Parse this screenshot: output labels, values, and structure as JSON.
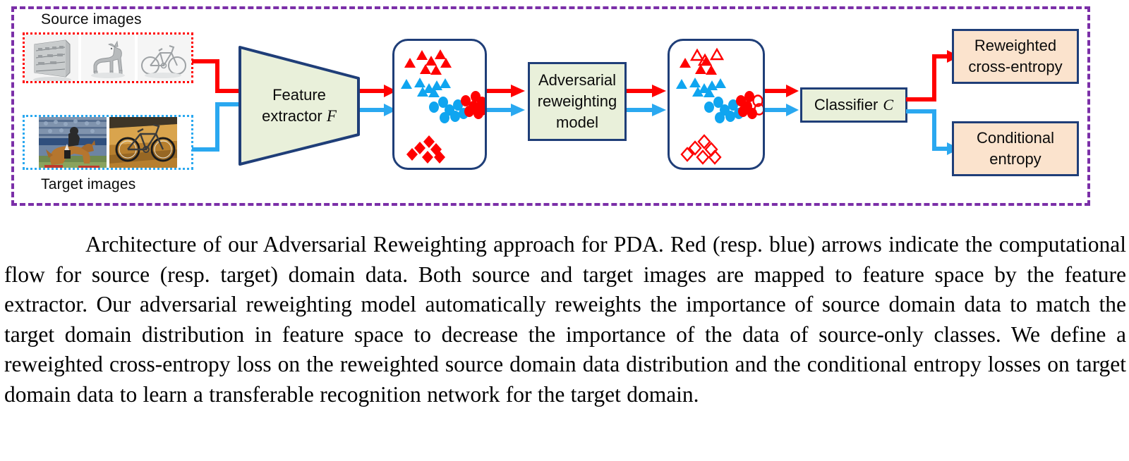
{
  "figure": {
    "outer_frame_color": "#7b2fa8",
    "source_label": "Source images",
    "target_label": "Target images",
    "source_border_color": "#ff0000",
    "target_border_color": "#2aa8f0",
    "source_thumbnails": [
      {
        "name": "synthetic-shelf-image",
        "alt": "grayscale synthetic rendering of a shelf unit"
      },
      {
        "name": "synthetic-horse-image",
        "alt": "grayscale synthetic rendering of a horse"
      },
      {
        "name": "synthetic-bicycle-image",
        "alt": "grayscale synthetic rendering of a bicycle"
      }
    ],
    "target_thumbnails": [
      {
        "name": "real-horse-image",
        "alt": "real photo of a horse and rider jumping"
      },
      {
        "name": "real-bicycle-image",
        "alt": "real photo of a bicycle"
      }
    ],
    "feature_extractor": {
      "line1": "Feature",
      "line2": "extractor",
      "symbol": "F"
    },
    "adversarial_model": {
      "line1": "Adversarial",
      "line2": "reweighting",
      "line3": "model"
    },
    "classifier": {
      "label": "Classifier",
      "symbol": "C"
    },
    "outputs": [
      {
        "name": "reweighted-cross-entropy",
        "line1": "Reweighted",
        "line2": "cross-entropy"
      },
      {
        "name": "conditional-entropy",
        "line1": "Conditional",
        "line2": "entropy"
      }
    ],
    "source_flow_color": "#ff0000",
    "target_flow_color": "#2aa8f0",
    "box_fill_process": "#e9f0da",
    "box_fill_output": "#fbe3cd",
    "box_border": "#1f3e78"
  },
  "chart_data": {
    "type": "scatter",
    "title": "Feature space point clouds",
    "panels": [
      {
        "name": "feature-space-before-reweighting",
        "note": "All source points are solid (full weight)",
        "series": [
          {
            "name": "source-class-A (red triangles)",
            "color": "#ff0000",
            "marker": "triangle",
            "filled": true,
            "points": [
              [
                28,
                34
              ],
              [
                46,
                22
              ],
              [
                60,
                30
              ],
              [
                73,
                21
              ],
              [
                52,
                40
              ],
              [
                68,
                41
              ],
              [
                84,
                33
              ]
            ]
          },
          {
            "name": "target-class-A (blue triangles)",
            "color": "#0fa5f0",
            "marker": "triangle",
            "filled": true,
            "points": [
              [
                24,
                62
              ],
              [
                43,
                60
              ],
              [
                57,
                69
              ],
              [
                68,
                65
              ],
              [
                80,
                62
              ],
              [
                47,
                74
              ],
              [
                64,
                75
              ]
            ]
          },
          {
            "name": "target-class-B (blue circles)",
            "color": "#0fa5f0",
            "marker": "circle",
            "filled": true,
            "points": [
              [
                64,
                95
              ],
              [
                78,
                88
              ],
              [
                87,
                99
              ],
              [
                99,
                92
              ],
              [
                95,
                108
              ],
              [
                80,
                110
              ],
              [
                108,
                104
              ]
            ]
          },
          {
            "name": "source-class-B (red circles)",
            "color": "#ff0000",
            "marker": "circle",
            "filled": true,
            "points": [
              [
                112,
                86
              ],
              [
                127,
                80
              ],
              [
                124,
                94
              ],
              [
                138,
                88
              ],
              [
                140,
                99
              ],
              [
                118,
                102
              ],
              [
                132,
                104
              ]
            ]
          },
          {
            "name": "source-only-class (red diamonds)",
            "color": "#ff0000",
            "marker": "diamond",
            "filled": true,
            "points": [
              [
                42,
                160
              ],
              [
                55,
                151
              ],
              [
                65,
                162
              ],
              [
                53,
                173
              ],
              [
                70,
                172
              ],
              [
                38,
                170
              ]
            ]
          }
        ]
      },
      {
        "name": "feature-space-after-reweighting",
        "note": "Source-only-class points become hollow (downweighted); some source class-A and class-B points hollow",
        "series": [
          {
            "name": "source-class-A (red triangles)",
            "color": "#ff0000",
            "marker": "triangle",
            "filled": "mixed",
            "points": [
              [
                28,
                34
              ],
              [
                46,
                22
              ],
              [
                60,
                30
              ],
              [
                73,
                21
              ],
              [
                52,
                40
              ],
              [
                68,
                41
              ],
              [
                84,
                33
              ]
            ],
            "hollow_indices": [
              1,
              3
            ]
          },
          {
            "name": "target-class-A (blue triangles)",
            "color": "#0fa5f0",
            "marker": "triangle",
            "filled": true,
            "points": [
              [
                24,
                62
              ],
              [
                43,
                60
              ],
              [
                57,
                69
              ],
              [
                68,
                65
              ],
              [
                80,
                62
              ],
              [
                47,
                74
              ],
              [
                64,
                75
              ]
            ]
          },
          {
            "name": "target-class-B (blue circles)",
            "color": "#0fa5f0",
            "marker": "circle",
            "filled": true,
            "points": [
              [
                64,
                95
              ],
              [
                78,
                88
              ],
              [
                87,
                99
              ],
              [
                99,
                92
              ],
              [
                95,
                108
              ],
              [
                80,
                110
              ],
              [
                108,
                104
              ]
            ]
          },
          {
            "name": "source-class-B (red circles)",
            "color": "#ff0000",
            "marker": "circle",
            "filled": "mixed",
            "points": [
              [
                112,
                86
              ],
              [
                127,
                80
              ],
              [
                124,
                94
              ],
              [
                138,
                88
              ],
              [
                140,
                99
              ],
              [
                118,
                102
              ],
              [
                132,
                104
              ]
            ],
            "hollow_indices": [
              3,
              4,
              6
            ]
          },
          {
            "name": "source-only-class (red diamonds)",
            "color": "#ff0000",
            "marker": "diamond",
            "filled": false,
            "points": [
              [
                42,
                160
              ],
              [
                55,
                151
              ],
              [
                65,
                162
              ],
              [
                53,
                173
              ],
              [
                70,
                172
              ],
              [
                38,
                170
              ]
            ]
          }
        ]
      }
    ]
  },
  "caption": {
    "text": "Architecture of our Adversarial Reweighting approach for PDA. Red (resp. blue) arrows indicate the computational flow for source (resp. target) domain data. Both source and target images are mapped to feature space by the feature extractor. Our adversarial reweighting model automatically reweights the importance of source domain data to match the target domain distribution in feature space to decrease the importance of the data of source-only classes. We define a reweighted cross-entropy loss on the reweighted source domain data distribution and the conditional entropy losses on target domain data to learn a transferable recognition network for the target domain."
  }
}
